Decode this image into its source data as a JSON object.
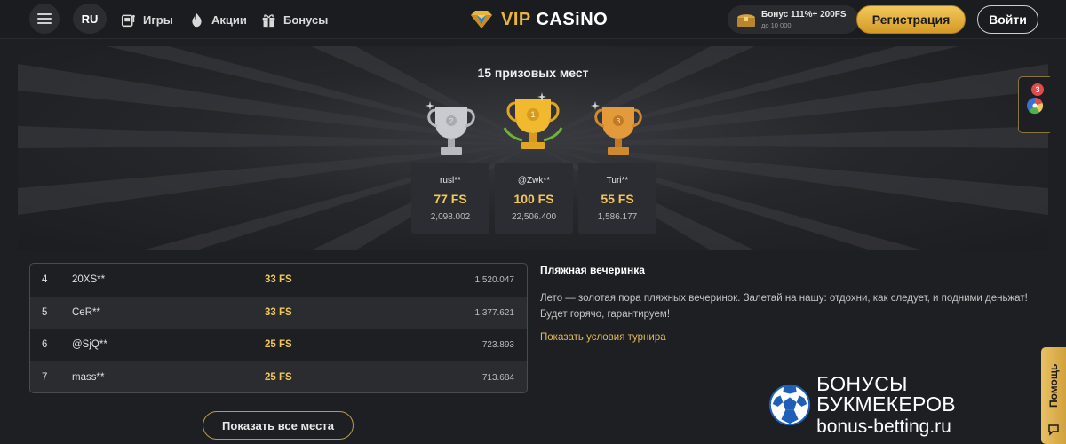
{
  "header": {
    "menu_icon": "hamburger-icon",
    "language": "RU",
    "nav": [
      {
        "label": "Игры",
        "icon": "slot-machine-icon"
      },
      {
        "label": "Акции",
        "icon": "flame-icon"
      },
      {
        "label": "Бонусы",
        "icon": "gift-icon"
      }
    ],
    "logo": {
      "vip": "VIP",
      "casino": "CASiNO",
      "icon": "diamond-icon"
    },
    "bonus": {
      "line1": "Бонус 111%+ 200FS",
      "line2": "до 10 000",
      "icon": "treasure-chest-icon"
    },
    "register_label": "Регистрация",
    "login_label": "Войти"
  },
  "podium": {
    "title": "15 призовых мест",
    "winners": [
      {
        "place": "2",
        "name": "rusl**",
        "prize": "77 FS",
        "score": "2,098.002",
        "trophy": "silver-trophy-icon"
      },
      {
        "place": "1",
        "name": "@Zwk**",
        "prize": "100 FS",
        "score": "22,506.400",
        "trophy": "gold-trophy-icon"
      },
      {
        "place": "3",
        "name": "Turi**",
        "prize": "55 FS",
        "score": "1,586.177",
        "trophy": "bronze-trophy-icon"
      }
    ]
  },
  "leaderboard": [
    {
      "rank": "4",
      "name": "20XS**",
      "prize": "33 FS",
      "score": "1,520.047"
    },
    {
      "rank": "5",
      "name": "CeR**",
      "prize": "33 FS",
      "score": "1,377.621"
    },
    {
      "rank": "6",
      "name": "@SjQ**",
      "prize": "25 FS",
      "score": "723.893"
    },
    {
      "rank": "7",
      "name": "mass**",
      "prize": "25 FS",
      "score": "713.684"
    }
  ],
  "show_all_label": "Показать все места",
  "tournament": {
    "title": "Пляжная вечеринка",
    "description": "Лето — золотая пора пляжных вечеринок. Залетай на нашу: отдохни, как следует, и подними деньжат! Будет горячо, гарантируем!",
    "conditions_link": "Показать условия турнира"
  },
  "side_widget": {
    "badge_count": "3",
    "icon": "fortune-wheel-icon"
  },
  "help": {
    "label": "Помощь",
    "icon": "chat-icon"
  },
  "watermark": {
    "line1": "БОНУСЫ БУКМЕКЕРОВ",
    "line2": "bonus-betting.ru",
    "icon": "soccer-ball-icon"
  },
  "colors": {
    "accent_gold": "#f2c85a",
    "background": "#1e1f22",
    "badge_red": "#e04b4b"
  }
}
